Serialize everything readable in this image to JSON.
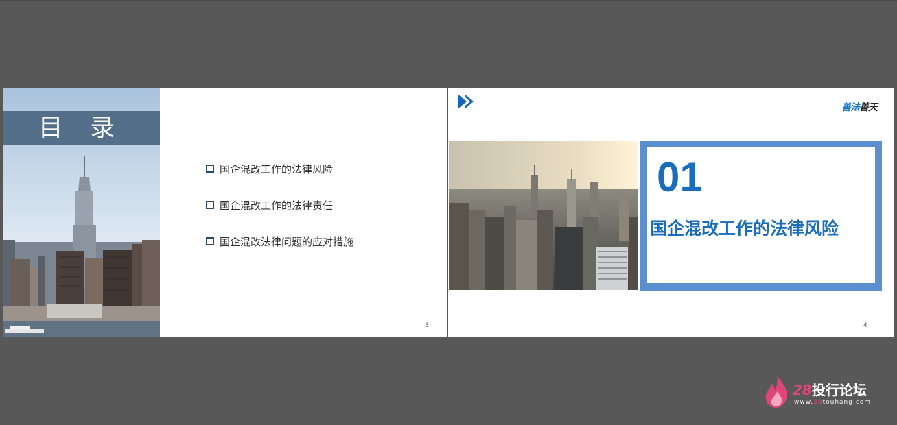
{
  "slide3": {
    "title": "目 录",
    "toc_items": [
      "国企混改工作的法律风险",
      "国企混改工作的法律责任",
      "国企混改法律问题的应对措施"
    ],
    "page_number": "3"
  },
  "slide4": {
    "logo_part1": "善法",
    "logo_part2": "善天",
    "section_number": "01",
    "section_title": "国企混改工作的法律风险",
    "page_number": "4",
    "accent_color": "#5b8fd0",
    "title_color": "#1a6cbd"
  },
  "watermark": {
    "brand_number": "28",
    "brand_text": "投行论坛",
    "url_prefix": "www.",
    "url_number": "28",
    "url_suffix": "touhang.com"
  }
}
